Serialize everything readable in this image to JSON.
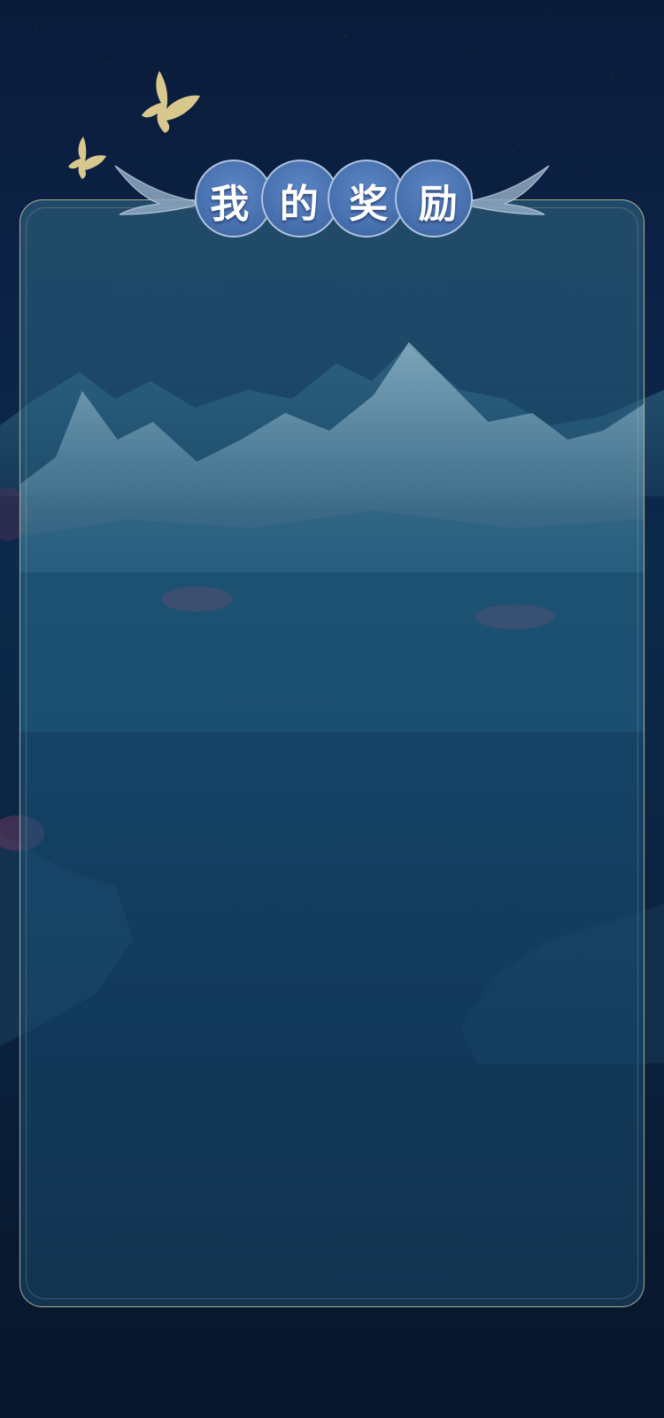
{
  "header": {
    "title_chars": [
      "我",
      "的",
      "奖",
      "励"
    ]
  },
  "colors": {
    "background": "#0c2346",
    "panel_border": "#e2d4a8",
    "title_badge": "#4a73b2",
    "butterfly": "#d9c88e"
  },
  "icons": {
    "decoration_left": "butterfly-icon",
    "wing_ornaments": "wing-icon"
  }
}
